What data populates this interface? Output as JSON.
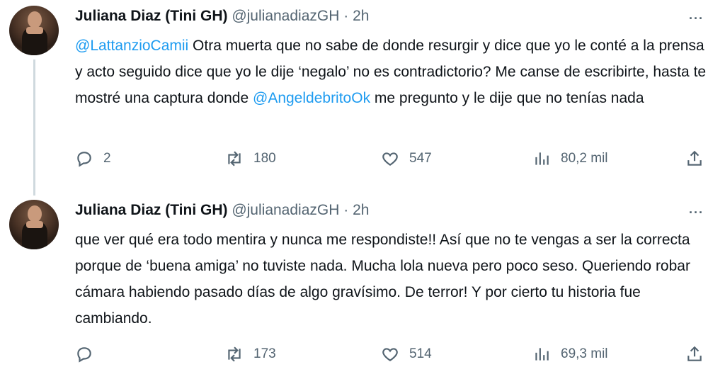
{
  "tweets": [
    {
      "name": "Juliana Diaz (Tini GH)",
      "handle": "@julianadiazGH",
      "separator": "·",
      "time": "2h",
      "more": "···",
      "text_parts": {
        "mention1": "@LattanzioCamii",
        "part1": " Otra muerta que no sabe de donde resurgir y dice que yo le conté a la prensa y acto seguido dice que yo le dije ‘negalo’ no es contradictorio? Me canse de escribirte, hasta te mostré una captura donde ",
        "mention2": "@AngeldebritoOk",
        "part2": " me pregunto y le dije que no tenías nada"
      },
      "actions": {
        "replies": "2",
        "retweets": "180",
        "likes": "547",
        "views": "80,2 mil"
      }
    },
    {
      "name": "Juliana Diaz (Tini GH)",
      "handle": "@julianadiazGH",
      "separator": "·",
      "time": "2h",
      "more": "···",
      "text": "que ver qué era todo mentira y nunca me respondiste!! Así que no te vengas a ser la correcta porque de ‘buena amiga’ no tuviste nada. Mucha lola nueva pero poco seso. Queriendo robar cámara habiendo pasado días de algo gravísimo. De terror! Y por cierto tu historia fue cambiando.",
      "actions": {
        "replies": "",
        "retweets": "173",
        "likes": "514",
        "views": "69,3 mil"
      }
    }
  ],
  "icons": [
    "reply-icon",
    "retweet-icon",
    "like-icon",
    "views-icon",
    "share-icon",
    "more-icon"
  ],
  "colors": {
    "mention": "#1d9bf0",
    "secondary": "#536471",
    "thread_line": "#cfd9de"
  }
}
